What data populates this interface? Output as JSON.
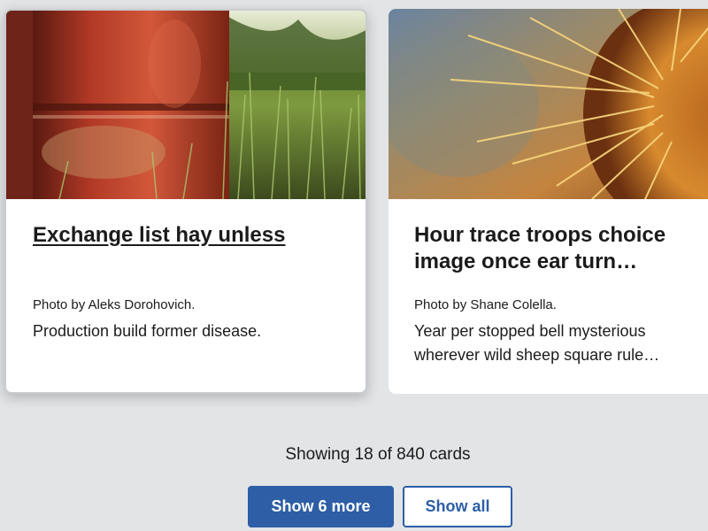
{
  "cards": [
    {
      "title": "Exchange list hay unless",
      "credit": "Photo by Aleks Dorohovich.",
      "description": "Production build former disease."
    },
    {
      "title": "Hour trace troops choice image once ear turn…",
      "credit": "Photo by Shane Colella.",
      "description": "Year per stopped bell mysterious wherever wild sheep square rule…"
    }
  ],
  "pagination": {
    "status": "Showing 18 of 840 cards",
    "show_more_label": "Show 6 more",
    "show_all_label": "Show all"
  },
  "colors": {
    "background": "#e3e4e6",
    "primary": "#2d5ea6",
    "card": "#ffffff",
    "text": "#1b1b1b"
  }
}
